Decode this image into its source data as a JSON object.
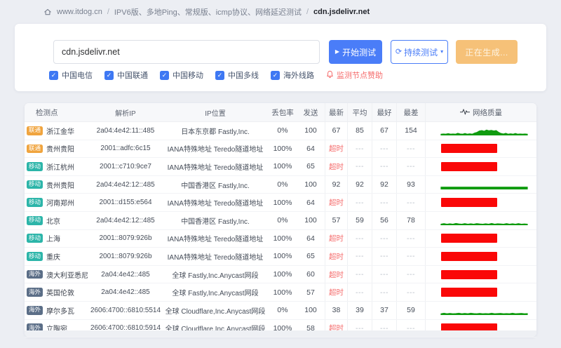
{
  "breadcrumb": {
    "home_label": "www.itdog.cn",
    "separator": "/",
    "path_label": "IPV6版、多地Ping、常规版、icmp协议、网络延迟测试",
    "current": "cdn.jsdelivr.net"
  },
  "toolbar": {
    "input_value": "cdn.jsdelivr.net",
    "start_button": "开始测试",
    "continuous_button": "持续测试",
    "generating_button": "正在生成...",
    "checkboxes": [
      "中国电信",
      "中国联通",
      "中国移动",
      "中国多线",
      "海外线路"
    ],
    "sponsor_link": "监测节点赞助"
  },
  "table": {
    "headers": [
      "检测点",
      "解析IP",
      "IP位置",
      "丢包率",
      "发送",
      "最新",
      "平均",
      "最好",
      "最差",
      "网络质量"
    ],
    "timeout_label": "超时",
    "empty_label": "---",
    "rows": [
      {
        "carrier": "联通",
        "carrier_type": "unicom",
        "name": "浙江金华",
        "ip": "2a04:4e42:11::485",
        "location": "日本东京都 Fastly,Inc.",
        "loss": "0%",
        "sent": "100",
        "latest": "67",
        "avg": "85",
        "best": "67",
        "worst": "154",
        "timeout": false,
        "quality": {
          "type": "line",
          "points": [
            0.1,
            0.12,
            0.1,
            0.16,
            0.1,
            0.12,
            0.1,
            0.2,
            0.12,
            0.1,
            0.18,
            0.1,
            0.14,
            0.1,
            0.22,
            0.3,
            0.45,
            0.5,
            0.42,
            0.55,
            0.48,
            0.52,
            0.45,
            0.5,
            0.3,
            0.18,
            0.12,
            0.2,
            0.1,
            0.14,
            0.1,
            0.18,
            0.1,
            0.12,
            0.1,
            0.12,
            0.1
          ]
        }
      },
      {
        "carrier": "联通",
        "carrier_type": "unicom",
        "name": "贵州贵阳",
        "ip": "2001::adfc:6c15",
        "location": "IANA特殊地址 Teredo隧道地址",
        "loss": "100%",
        "sent": "64",
        "latest": "超时",
        "avg": "---",
        "best": "---",
        "worst": "---",
        "timeout": true,
        "quality": {
          "type": "bar"
        }
      },
      {
        "carrier": "移动",
        "carrier_type": "mobile",
        "name": "浙江杭州",
        "ip": "2001::c710:9ce7",
        "location": "IANA特殊地址 Teredo隧道地址",
        "loss": "100%",
        "sent": "65",
        "latest": "超时",
        "avg": "---",
        "best": "---",
        "worst": "---",
        "timeout": true,
        "quality": {
          "type": "bar"
        }
      },
      {
        "carrier": "移动",
        "carrier_type": "mobile",
        "name": "贵州贵阳",
        "ip": "2a04:4e42:12::485",
        "location": "中国香港区 Fastly,Inc.",
        "loss": "0%",
        "sent": "100",
        "latest": "92",
        "avg": "92",
        "best": "92",
        "worst": "93",
        "timeout": false,
        "quality": {
          "type": "line",
          "points": [
            0.22,
            0.22
          ]
        }
      },
      {
        "carrier": "移动",
        "carrier_type": "mobile",
        "name": "河南郑州",
        "ip": "2001::d155:e564",
        "location": "IANA特殊地址 Teredo隧道地址",
        "loss": "100%",
        "sent": "64",
        "latest": "超时",
        "avg": "---",
        "best": "---",
        "worst": "---",
        "timeout": true,
        "quality": {
          "type": "bar"
        }
      },
      {
        "carrier": "移动",
        "carrier_type": "mobile",
        "name": "北京",
        "ip": "2a04:4e42:12::485",
        "location": "中国香港区 Fastly,Inc.",
        "loss": "0%",
        "sent": "100",
        "latest": "57",
        "avg": "59",
        "best": "56",
        "worst": "78",
        "timeout": false,
        "quality": {
          "type": "line",
          "points": [
            0.08,
            0.14,
            0.08,
            0.12,
            0.08,
            0.16,
            0.1,
            0.08,
            0.14,
            0.08,
            0.12,
            0.08,
            0.14,
            0.1,
            0.08,
            0.12,
            0.08,
            0.16,
            0.08,
            0.12,
            0.1,
            0.08,
            0.14,
            0.08,
            0.12,
            0.08,
            0.14,
            0.08,
            0.1,
            0.08
          ]
        }
      },
      {
        "carrier": "移动",
        "carrier_type": "mobile",
        "name": "上海",
        "ip": "2001::8079:926b",
        "location": "IANA特殊地址 Teredo隧道地址",
        "loss": "100%",
        "sent": "64",
        "latest": "超时",
        "avg": "---",
        "best": "---",
        "worst": "---",
        "timeout": true,
        "quality": {
          "type": "bar"
        }
      },
      {
        "carrier": "移动",
        "carrier_type": "mobile",
        "name": "重庆",
        "ip": "2001::8079:926b",
        "location": "IANA特殊地址 Teredo隧道地址",
        "loss": "100%",
        "sent": "65",
        "latest": "超时",
        "avg": "---",
        "best": "---",
        "worst": "---",
        "timeout": true,
        "quality": {
          "type": "bar"
        }
      },
      {
        "carrier": "海外",
        "carrier_type": "overseas",
        "name": "澳大利亚悉尼",
        "ip": "2a04:4e42::485",
        "location": "全球 Fastly,Inc.Anycast网段",
        "loss": "100%",
        "sent": "60",
        "latest": "超时",
        "avg": "---",
        "best": "---",
        "worst": "---",
        "timeout": true,
        "quality": {
          "type": "bar"
        }
      },
      {
        "carrier": "海外",
        "carrier_type": "overseas",
        "name": "英国伦敦",
        "ip": "2a04:4e42::485",
        "location": "全球 Fastly,Inc.Anycast网段",
        "loss": "100%",
        "sent": "57",
        "latest": "超时",
        "avg": "---",
        "best": "---",
        "worst": "---",
        "timeout": true,
        "quality": {
          "type": "bar"
        }
      },
      {
        "carrier": "海外",
        "carrier_type": "overseas",
        "name": "摩尔多瓦",
        "ip": "2606:4700::6810:5514",
        "location": "全球 Cloudflare,Inc.Anycast网段",
        "loss": "0%",
        "sent": "100",
        "latest": "38",
        "avg": "39",
        "best": "37",
        "worst": "59",
        "timeout": false,
        "quality": {
          "type": "line",
          "points": [
            0.1,
            0.16,
            0.1,
            0.14,
            0.1,
            0.12,
            0.16,
            0.1,
            0.14,
            0.1,
            0.16,
            0.12,
            0.1,
            0.14,
            0.1,
            0.12,
            0.1,
            0.16,
            0.1,
            0.12,
            0.14,
            0.1,
            0.12,
            0.1,
            0.16,
            0.1,
            0.12,
            0.14,
            0.1,
            0.12
          ]
        }
      },
      {
        "carrier": "海外",
        "carrier_type": "overseas",
        "name": "立陶宛",
        "ip": "2606:4700::6810:5914",
        "location": "全球 Cloudflare,Inc.Anycast网段",
        "loss": "100%",
        "sent": "58",
        "latest": "超时",
        "avg": "---",
        "best": "---",
        "worst": "---",
        "timeout": true,
        "quality": {
          "type": "bar"
        }
      }
    ]
  },
  "colors": {
    "accent_blue": "#4a7df8",
    "disabled_orange": "#f6c178",
    "timeout_red": "#f56c6c",
    "quality_green": "#0f9b0f",
    "quality_red": "#fa0808",
    "badges": {
      "telecom": "#4e80f0",
      "unicom": "#f0a43e",
      "mobile": "#2cb5a9",
      "overseas": "#5b6e87"
    }
  }
}
